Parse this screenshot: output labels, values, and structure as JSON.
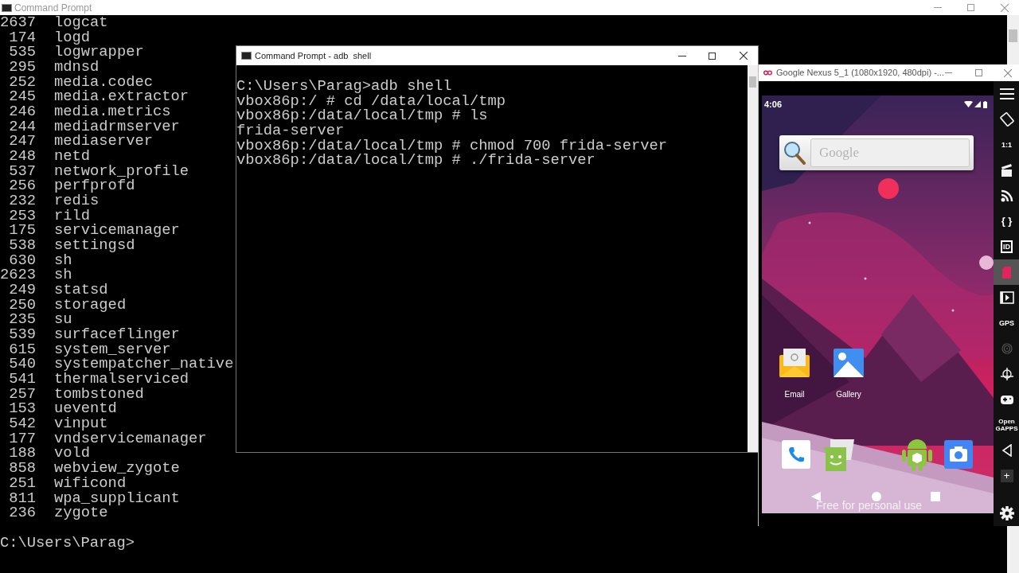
{
  "main_window": {
    "title": "Command Prompt",
    "processes": [
      {
        "pid": "2637",
        "name": "logcat"
      },
      {
        "pid": "174",
        "name": "logd"
      },
      {
        "pid": "535",
        "name": "logwrapper"
      },
      {
        "pid": "295",
        "name": "mdnsd"
      },
      {
        "pid": "252",
        "name": "media.codec"
      },
      {
        "pid": "245",
        "name": "media.extractor"
      },
      {
        "pid": "246",
        "name": "media.metrics"
      },
      {
        "pid": "244",
        "name": "mediadrmserver"
      },
      {
        "pid": "247",
        "name": "mediaserver"
      },
      {
        "pid": "248",
        "name": "netd"
      },
      {
        "pid": "537",
        "name": "network_profile"
      },
      {
        "pid": "256",
        "name": "perfprofd"
      },
      {
        "pid": "232",
        "name": "redis"
      },
      {
        "pid": "253",
        "name": "rild"
      },
      {
        "pid": "175",
        "name": "servicemanager"
      },
      {
        "pid": "538",
        "name": "settingsd"
      },
      {
        "pid": "630",
        "name": "sh"
      },
      {
        "pid": "2623",
        "name": "sh"
      },
      {
        "pid": "249",
        "name": "statsd"
      },
      {
        "pid": "250",
        "name": "storaged"
      },
      {
        "pid": "235",
        "name": "su"
      },
      {
        "pid": "539",
        "name": "surfaceflinger"
      },
      {
        "pid": "615",
        "name": "system_server"
      },
      {
        "pid": "540",
        "name": "systempatcher_native"
      },
      {
        "pid": "541",
        "name": "thermalserviced"
      },
      {
        "pid": "257",
        "name": "tombstoned"
      },
      {
        "pid": "153",
        "name": "ueventd"
      },
      {
        "pid": "542",
        "name": "vinput"
      },
      {
        "pid": "177",
        "name": "vndservicemanager"
      },
      {
        "pid": "188",
        "name": "vold"
      },
      {
        "pid": "858",
        "name": "webview_zygote"
      },
      {
        "pid": "251",
        "name": "wificond"
      },
      {
        "pid": "811",
        "name": "wpa_supplicant"
      },
      {
        "pid": "236",
        "name": "zygote"
      }
    ],
    "prompt": "C:\\Users\\Parag>"
  },
  "shell_window": {
    "title": "Command Prompt - adb  shell",
    "lines": [
      "C:\\Users\\Parag>adb shell",
      "vbox86p:/ # cd /data/local/tmp",
      "vbox86p:/data/local/tmp # ls",
      "frida-server",
      "vbox86p:/data/local/tmp # chmod 700 frida-server",
      "vbox86p:/data/local/tmp # ./frida-server"
    ]
  },
  "emulator": {
    "title": "Google Nexus 5_1 (1080x1920, 480dpi) -...",
    "time": "4:06",
    "search_placeholder": "Google",
    "apps": [
      {
        "kind": "email",
        "label": "Email"
      },
      {
        "kind": "gallery",
        "label": "Gallery"
      }
    ],
    "notice": "Free for personal use",
    "toolbar": [
      {
        "kind": "menu",
        "selected": false
      },
      {
        "kind": "rotate",
        "selected": false
      },
      {
        "kind": "scale",
        "label": "1:1",
        "selected": false
      },
      {
        "kind": "capture",
        "selected": false
      },
      {
        "kind": "signal",
        "selected": false
      },
      {
        "kind": "braces",
        "label": "{ }",
        "selected": false
      },
      {
        "kind": "id",
        "label": "ID",
        "selected": false
      },
      {
        "kind": "sim",
        "selected": true
      },
      {
        "kind": "video",
        "selected": false
      },
      {
        "kind": "gps",
        "label": "GPS",
        "selected": false
      },
      {
        "kind": "fingerprint",
        "selected": false
      },
      {
        "kind": "gyro",
        "selected": false
      },
      {
        "kind": "gamepad",
        "selected": false
      },
      {
        "kind": "gapps",
        "label": "Open GAPPS",
        "selected": false
      },
      {
        "kind": "back",
        "selected": false
      },
      {
        "kind": "plus",
        "label": "+",
        "selected": false
      },
      {
        "kind": "settings",
        "selected": false
      }
    ]
  }
}
